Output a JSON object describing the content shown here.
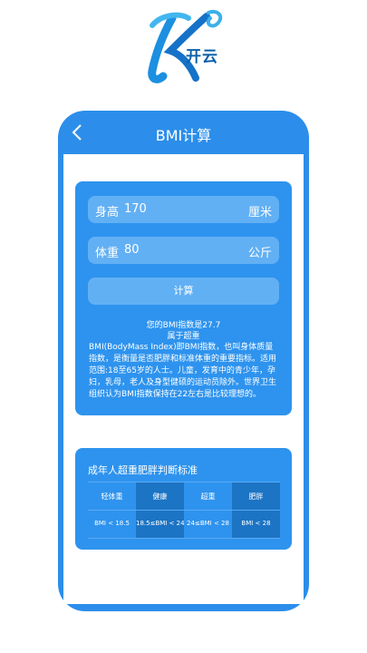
{
  "logo": {
    "text": "开云"
  },
  "nav": {
    "title": "BMI计算"
  },
  "form": {
    "height_label": "身高",
    "height_value": "170",
    "height_unit": "厘米",
    "weight_label": "体重",
    "weight_value": "80",
    "weight_unit": "公斤",
    "calc_label": "计算"
  },
  "result": {
    "line1": "您的BMI指数是27.7",
    "line2": "属于超重"
  },
  "description": "BMI(BodyMass Index)即BMI指数，也叫身体质量指数，是衡量是否肥胖和标准体重的重要指标。适用范围:18至65岁的人士。儿童，发育中的青少年，孕妇，乳母，老人及身型健硕的运动员除外。世界卫生组织认为BMI指数保持在22左右是比较理想的。",
  "standards": {
    "title": "成年人超重肥胖判断标准",
    "headers": [
      "轻体重",
      "健康",
      "超重",
      "肥胖"
    ],
    "values": [
      "BMI < 18.5",
      "18.5≤BMI < 24",
      "24≤BMI < 28",
      "BMI < 28"
    ]
  },
  "colors": {
    "primary": "#2e93ee",
    "field": "#62b0f4",
    "highlight": "#1c74c4"
  }
}
